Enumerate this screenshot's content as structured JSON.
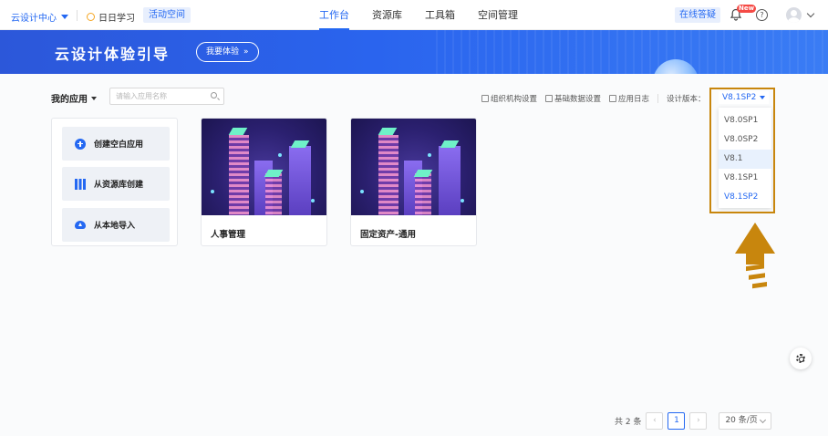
{
  "topbar": {
    "brand": "云设计中心",
    "daily_study": "日日学习",
    "activity_space": "活动空间",
    "nav_tabs": [
      "工作台",
      "资源库",
      "工具箱",
      "空间管理"
    ],
    "online_qa": "在线答疑",
    "new_badge": "New",
    "help_glyph": "?"
  },
  "banner": {
    "title": "云设计体验引导",
    "cta": "我要体验",
    "cta_arrow": "»"
  },
  "toolbar": {
    "my_apps": "我的应用",
    "search_placeholder": "请输入应用名称",
    "links": [
      "组织机构设置",
      "基础数据设置",
      "应用日志"
    ],
    "design_version_label": "设计版本：",
    "version_value": "V8.1SP2"
  },
  "version_dropdown": {
    "options": [
      "V8.0SP1",
      "V8.0SP2",
      "V8.1",
      "V8.1SP1",
      "V8.1SP2"
    ],
    "hovered": "V8.1",
    "selected": "V8.1SP2"
  },
  "create_card": {
    "buttons": [
      "创建空白应用",
      "从资源库创建",
      "从本地导入"
    ]
  },
  "apps": [
    {
      "name": "人事管理"
    },
    {
      "name": "固定资产-通用"
    }
  ],
  "pagination": {
    "total_text": "共 2 条",
    "prev": "‹",
    "current_page": "1",
    "next": "›",
    "page_size": "20 条/页"
  },
  "colors": {
    "accent": "#2468f2",
    "highlight": "#c8860d"
  }
}
